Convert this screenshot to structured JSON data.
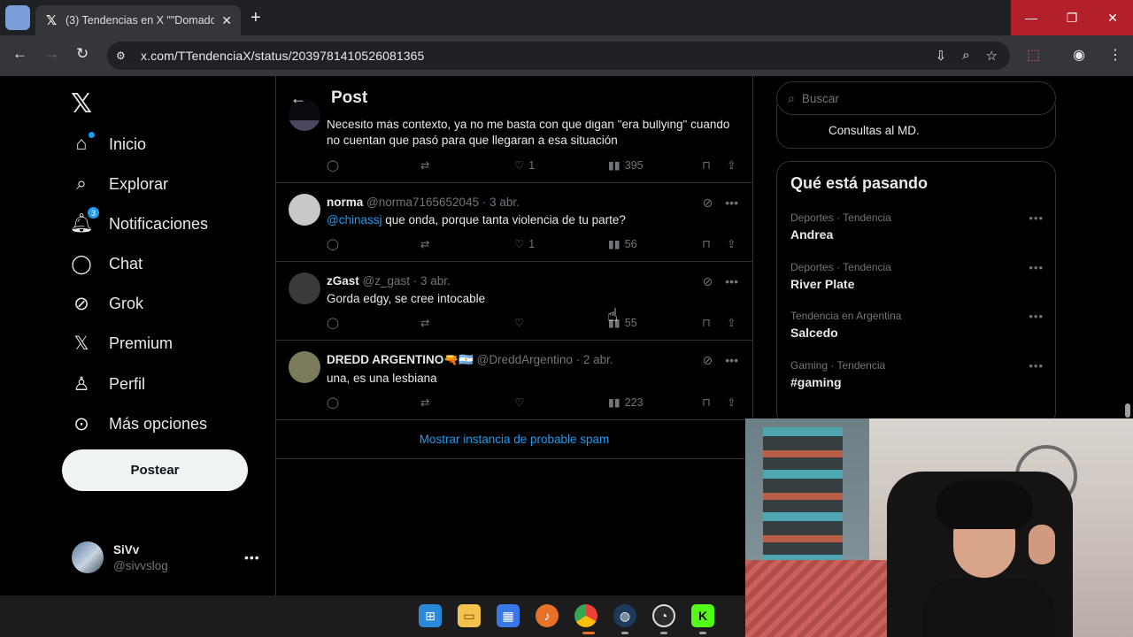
{
  "browser": {
    "tab_title": "(3) Tendencias en X \"\"Domado",
    "url": "x.com/TTendenciaX/status/2039781410526081365",
    "window_buttons": [
      "—",
      "❐",
      "✕"
    ]
  },
  "nav": {
    "items": [
      {
        "label": "Inicio",
        "icon": "home-icon"
      },
      {
        "label": "Explorar",
        "icon": "search-icon"
      },
      {
        "label": "Notificaciones",
        "icon": "bell-icon",
        "badge": "3"
      },
      {
        "label": "Chat",
        "icon": "chat-icon"
      },
      {
        "label": "Grok",
        "icon": "grok-icon"
      },
      {
        "label": "Premium",
        "icon": "x-icon"
      },
      {
        "label": "Perfil",
        "icon": "person-icon"
      },
      {
        "label": "Más opciones",
        "icon": "more-circle-icon"
      }
    ],
    "post_button": "Postear",
    "profile": {
      "name": "SiVv",
      "handle": "@sivvslog"
    }
  },
  "main": {
    "title": "Post",
    "replies": [
      {
        "name": "",
        "handle": "",
        "date": "",
        "text": "Necesito más contexto, ya no me basta con que digan \"era bullying\" cuando no cuentan que pasó para que llegaran a esa situación",
        "likes": "1",
        "views": "395"
      },
      {
        "name": "norma",
        "handle": "@norma7165652045 · 3 abr.",
        "mention": "@chinassj",
        "text": " que onda, porque tanta violencia de tu parte?",
        "likes": "1",
        "views": "56"
      },
      {
        "name": "zGast",
        "handle": "@z_gast · 3 abr.",
        "text": "Gorda edgy, se cree intocable",
        "likes": "",
        "views": "55"
      },
      {
        "name": "DREDD ARGENTINO🔫🇦🇷",
        "handle": "@DreddArgentino · 2 abr.",
        "text": "una, es una lesbiana",
        "likes": "",
        "views": "223"
      }
    ],
    "spam_link": "Mostrar instancia de probable spam"
  },
  "right": {
    "search_placeholder": "Buscar",
    "prev_card_text": "Consultas al MD.",
    "trends_title": "Qué está pasando",
    "trends": [
      {
        "meta": "Deportes · Tendencia",
        "name": "Andrea"
      },
      {
        "meta": "Deportes · Tendencia",
        "name": "River Plate"
      },
      {
        "meta": "Tendencia en Argentina",
        "name": "Salcedo"
      },
      {
        "meta": "Gaming · Tendencia",
        "name": "#gaming"
      }
    ]
  },
  "colors": {
    "accent": "#1d9bf0",
    "background": "#000000",
    "border": "#2f3336",
    "muted": "#71767b"
  }
}
